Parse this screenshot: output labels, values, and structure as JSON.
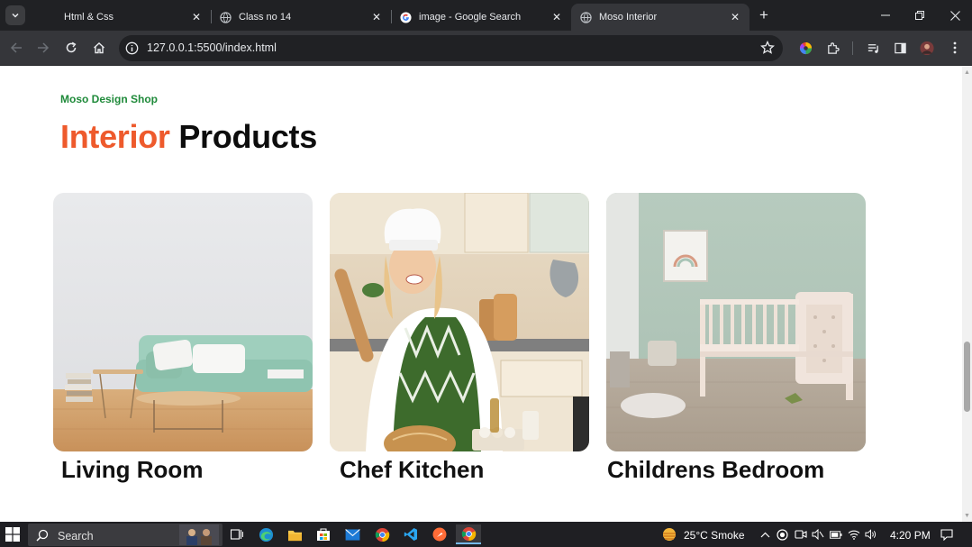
{
  "browser": {
    "tabs": [
      {
        "label": "Html & Css",
        "icon": "document-icon",
        "active": false
      },
      {
        "label": "Class no 14",
        "icon": "globe-icon",
        "active": false
      },
      {
        "label": "image - Google Search",
        "icon": "google-icon",
        "active": false
      },
      {
        "label": "Moso Interior",
        "icon": "globe-icon",
        "active": true
      }
    ],
    "url": "127.0.0.1:5500/index.html"
  },
  "page": {
    "eyebrow": "Moso Design Shop",
    "headline_accent": "Interior",
    "headline_rest": "Products",
    "accent_color": "#ee5a2c",
    "eyebrow_color": "#1f8a3a",
    "products": [
      {
        "title": "Living Room",
        "image": "living-room-image"
      },
      {
        "title": "Chef Kitchen",
        "image": "chef-kitchen-image"
      },
      {
        "title": "Childrens Bedroom",
        "image": "childrens-bedroom-image"
      }
    ]
  },
  "taskbar": {
    "search_label": "Search",
    "weather": "25°C  Smoke",
    "time": "4:20 PM"
  }
}
